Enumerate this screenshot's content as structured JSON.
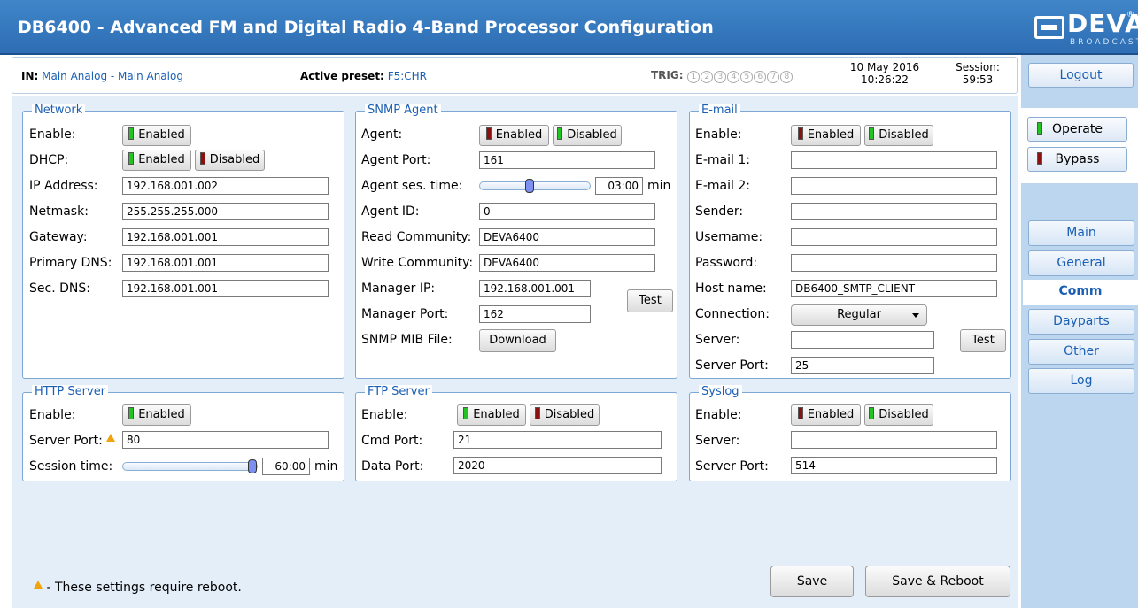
{
  "title": "DB6400 - Advanced FM and Digital Radio 4-Band Processor Configuration",
  "logo": {
    "text": "DEVA",
    "sub": "BROADCAST",
    "reg": "®"
  },
  "info": {
    "in_label": "IN:",
    "in_value": "Main Analog - Main Analog",
    "preset_label": "Active preset:",
    "preset_value": "F5:CHR",
    "trig_label": "TRIG:",
    "trig_items": [
      "1",
      "2",
      "3",
      "4",
      "5",
      "6",
      "7",
      "8"
    ],
    "date": "10 May 2016",
    "time": "10:26:22",
    "session_label": "Session:",
    "session_value": "59:53"
  },
  "sidebar": {
    "logout": "Logout",
    "operate": "Operate",
    "bypass": "Bypass",
    "tabs": [
      "Main",
      "General",
      "Comm",
      "Dayparts",
      "Other",
      "Log"
    ],
    "active_tab": "Comm"
  },
  "common": {
    "enabled": "Enabled",
    "disabled": "Disabled",
    "test": "Test",
    "min": "min"
  },
  "network": {
    "title": "Network",
    "enable_label": "Enable:",
    "dhcp_label": "DHCP:",
    "ip_label": "IP Address:",
    "ip": "192.168.001.002",
    "netmask_label": "Netmask:",
    "netmask": "255.255.255.000",
    "gateway_label": "Gateway:",
    "gateway": "192.168.001.001",
    "pdns_label": "Primary DNS:",
    "pdns": "192.168.001.001",
    "sdns_label": "Sec. DNS:",
    "sdns": "192.168.001.001"
  },
  "snmp": {
    "title": "SNMP Agent",
    "agent_label": "Agent:",
    "port_label": "Agent Port:",
    "port": "161",
    "sestime_label": "Agent ses. time:",
    "sestime": "03:00",
    "sestime_level": 0.45,
    "id_label": "Agent ID:",
    "id": "0",
    "read_label": "Read Community:",
    "read": "DEVA6400",
    "write_label": "Write Community:",
    "write": "DEVA6400",
    "mgrip_label": "Manager IP:",
    "mgrip": "192.168.001.001",
    "mgrport_label": "Manager Port:",
    "mgrport": "162",
    "mib_label": "SNMP MIB File:",
    "download": "Download"
  },
  "email": {
    "title": "E-mail",
    "enable_label": "Enable:",
    "e1_label": "E-mail 1:",
    "e1": "",
    "e2_label": "E-mail 2:",
    "e2": "",
    "sender_label": "Sender:",
    "sender": "",
    "user_label": "Username:",
    "user": "",
    "pass_label": "Password:",
    "pass": "",
    "host_label": "Host name:",
    "host": "DB6400_SMTP_CLIENT",
    "conn_label": "Connection:",
    "conn": "Regular",
    "server_label": "Server:",
    "server": "",
    "sport_label": "Server Port:",
    "sport": "25"
  },
  "http": {
    "title": "HTTP Server",
    "enable_label": "Enable:",
    "port_label": "Server Port:",
    "port": "80",
    "sestime_label": "Session time:",
    "sestime": "60:00",
    "sestime_level": 1.0
  },
  "ftp": {
    "title": "FTP Server",
    "enable_label": "Enable:",
    "cmd_label": "Cmd Port:",
    "cmd": "21",
    "data_label": "Data Port:",
    "data": "2020"
  },
  "syslog": {
    "title": "Syslog",
    "enable_label": "Enable:",
    "server_label": "Server:",
    "server": "",
    "port_label": "Server Port:",
    "port": "514"
  },
  "footer": {
    "note": "- These settings require reboot.",
    "save": "Save",
    "save_reboot": "Save & Reboot"
  },
  "colors": {
    "accent": "#2e6db3",
    "led_on": "#22c322",
    "led_off": "#8b1010",
    "link": "#1a5fb4"
  }
}
